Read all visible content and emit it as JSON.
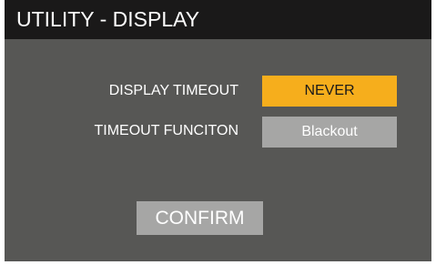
{
  "header": {
    "title": "UTILITY - DISPLAY"
  },
  "settings": [
    {
      "label": "DISPLAY TIMEOUT",
      "value": "NEVER",
      "state": "selected"
    },
    {
      "label": "TIMEOUT FUNCITON",
      "value": "Blackout",
      "state": "unselected"
    }
  ],
  "actions": {
    "confirm_label": "CONFIRM"
  },
  "colors": {
    "panel_background": "#575755",
    "title_bar": "#1a1919",
    "selected_accent": "#f6ae1c",
    "unselected_box": "#a6a6a5",
    "text": "#ffffff"
  }
}
